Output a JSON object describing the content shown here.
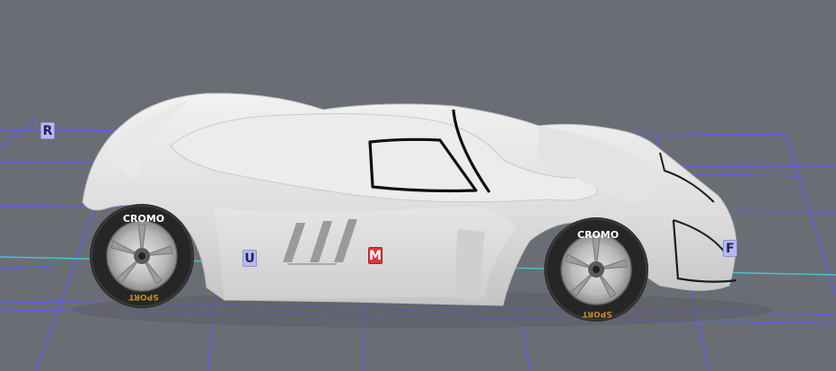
{
  "scene": {
    "background_color": "#6b6d74",
    "grid_color": "#5b5ef0",
    "axis_color": "#42c3cf"
  },
  "car": {
    "body_color": "#dcdcdc",
    "front_tire": {
      "brand": "CROMO",
      "sidewall": "SPORT"
    },
    "rear_tire": {
      "brand": "CROMO",
      "sidewall": "SPORT"
    }
  },
  "markers": {
    "rear": {
      "label": "R",
      "color": "#b7b9f4"
    },
    "up": {
      "label": "U",
      "color": "#b7b9f4"
    },
    "middle": {
      "label": "M",
      "color": "#e2333a"
    },
    "front": {
      "label": "F",
      "color": "#b7b9f4"
    }
  }
}
